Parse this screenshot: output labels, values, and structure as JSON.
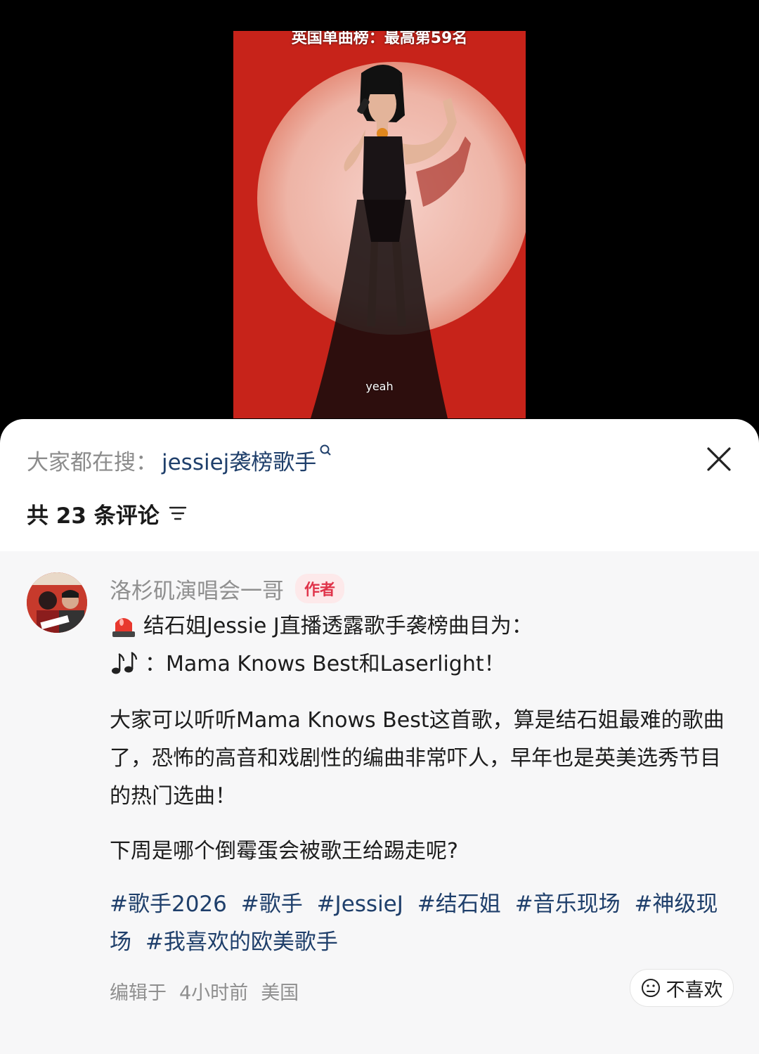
{
  "video": {
    "title": "英国单曲榜：最高第59名",
    "subtitle": "yeah"
  },
  "sheet": {
    "search_prefix": "大家都在搜：",
    "search_term": "jessiej袭榜歌手",
    "comment_count_label": "共 23 条评论"
  },
  "comment": {
    "author": "洛杉矶演唱会一哥",
    "author_badge": "作者",
    "line1_text": "结石姐Jessie J直播透露歌手袭榜曲目为：",
    "line2_text": "：Mama Knows Best和Laserlight！",
    "paragraph2": "大家可以听听Mama Knows Best这首歌，算是结石姐最难的歌曲了，恐怖的高音和戏剧性的编曲非常吓人，早年也是英美选秀节目的热门选曲！",
    "paragraph3": "下周是哪个倒霉蛋会被歌王给踢走呢?",
    "hashtags": [
      "#歌手2026",
      "#歌手",
      "#JessieJ",
      "#结石姐",
      "#音乐现场",
      "#神级现场",
      "#我喜欢的欧美歌手"
    ],
    "edited_label": "编辑于",
    "time": "4小时前",
    "location": "美国",
    "dislike_label": "不喜欢"
  },
  "colors": {
    "video_bg": "#c7231a",
    "hashtag": "#1f3f6b",
    "badge_text": "#e0344a",
    "badge_bg": "#fde9ea"
  }
}
